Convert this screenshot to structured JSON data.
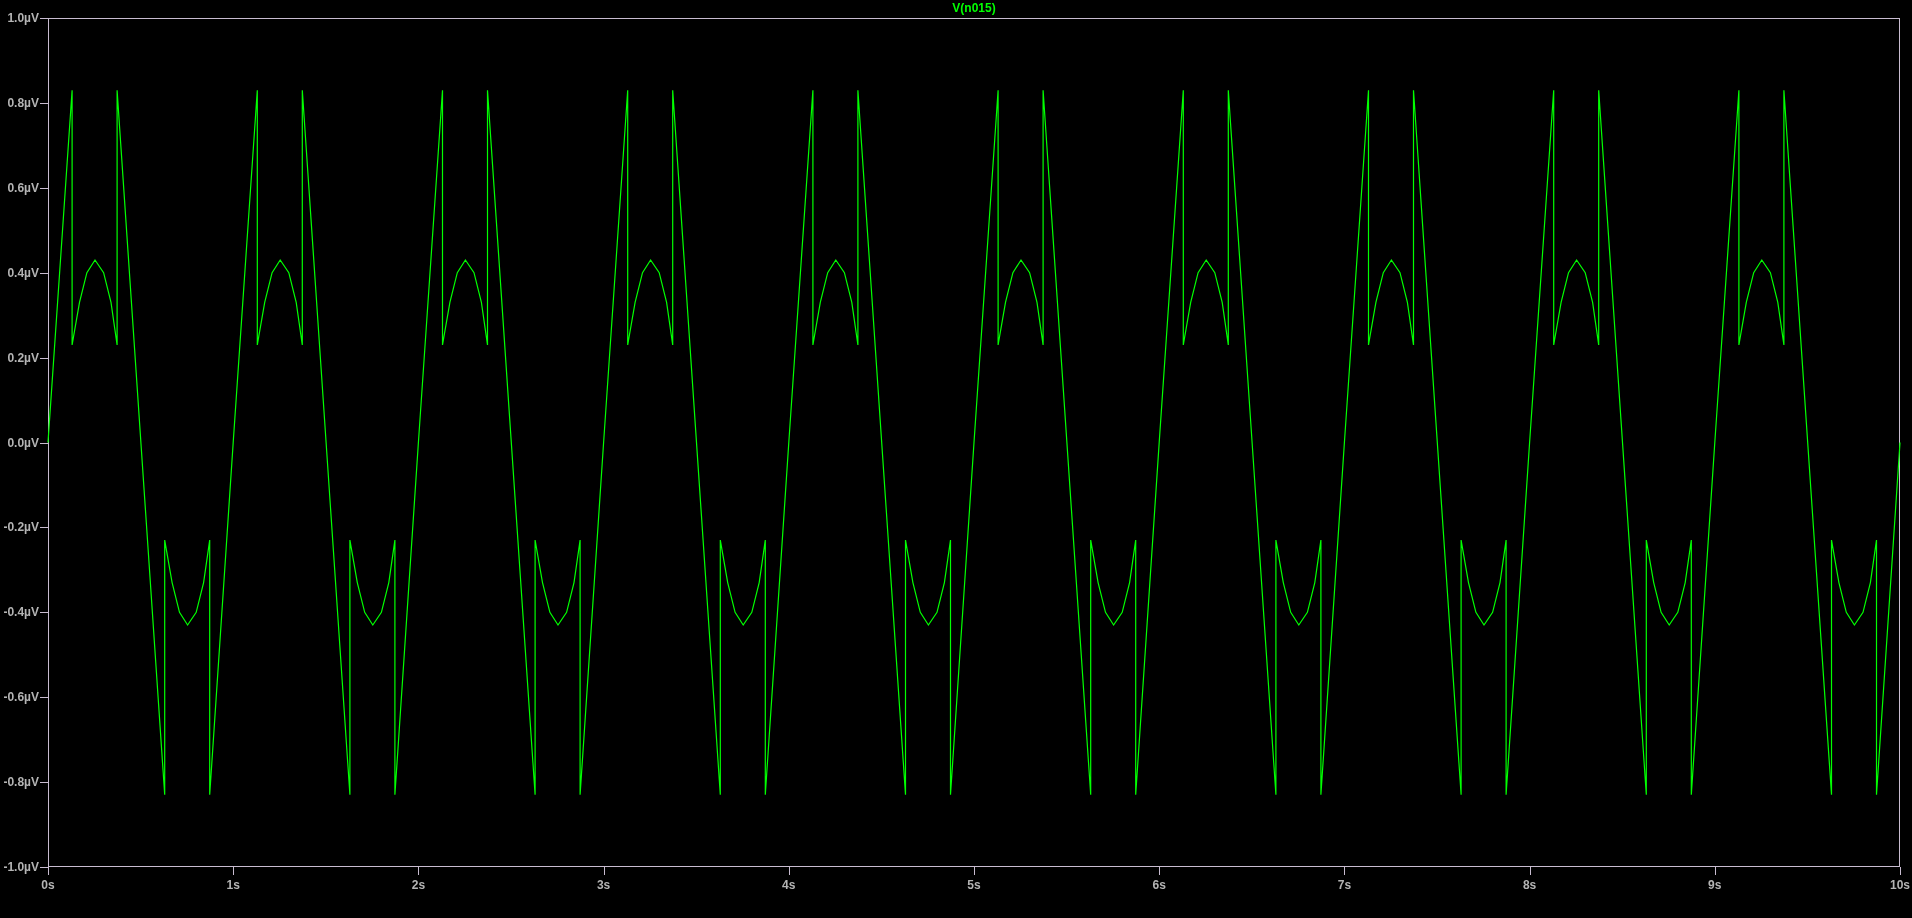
{
  "plot": {
    "chart_data": {
      "type": "line",
      "xlim": [
        0,
        10
      ],
      "ylim": [
        -1,
        1
      ],
      "xticks": [
        {
          "value": 0,
          "label": "0s"
        },
        {
          "value": 1,
          "label": "1s"
        },
        {
          "value": 2,
          "label": "2s"
        },
        {
          "value": 3,
          "label": "3s"
        },
        {
          "value": 4,
          "label": "4s"
        },
        {
          "value": 5,
          "label": "5s"
        },
        {
          "value": 6,
          "label": "6s"
        },
        {
          "value": 7,
          "label": "7s"
        },
        {
          "value": 8,
          "label": "8s"
        },
        {
          "value": 9,
          "label": "9s"
        },
        {
          "value": 10,
          "label": "10s"
        }
      ],
      "yticks": [
        {
          "value": 1,
          "label": "1.0µV"
        },
        {
          "value": 0.8,
          "label": "0.8µV"
        },
        {
          "value": 0.6,
          "label": "0.6µV"
        },
        {
          "value": 0.4,
          "label": "0.4µV"
        },
        {
          "value": 0.2,
          "label": "0.2µV"
        },
        {
          "value": 0,
          "label": "0.0µV"
        },
        {
          "value": -0.2,
          "label": "-0.2µV"
        },
        {
          "value": -0.4,
          "label": "-0.4µV"
        },
        {
          "value": -0.6,
          "label": "-0.6µV"
        },
        {
          "value": -0.8,
          "label": "-0.8µV"
        },
        {
          "value": -1,
          "label": "-1.0µV"
        }
      ],
      "x": [
        0,
        0.13,
        0.13,
        0.17,
        0.21,
        0.254,
        0.3,
        0.34,
        0.373,
        0.373,
        0.63,
        0.63,
        0.67,
        0.71,
        0.754,
        0.8,
        0.84,
        0.873,
        0.873,
        1,
        1.13,
        1.13,
        1.17,
        1.21,
        1.254,
        1.3,
        1.34,
        1.373,
        1.373,
        1.63,
        1.63,
        1.67,
        1.71,
        1.754,
        1.8,
        1.84,
        1.873,
        1.873,
        2,
        2.13,
        2.13,
        2.17,
        2.21,
        2.254,
        2.3,
        2.34,
        2.373,
        2.373,
        2.63,
        2.63,
        2.67,
        2.71,
        2.754,
        2.8,
        2.84,
        2.873,
        2.873,
        3,
        3.13,
        3.13,
        3.17,
        3.21,
        3.254,
        3.3,
        3.34,
        3.373,
        3.373,
        3.63,
        3.63,
        3.67,
        3.71,
        3.754,
        3.8,
        3.84,
        3.873,
        3.873,
        4,
        4.13,
        4.13,
        4.17,
        4.21,
        4.254,
        4.3,
        4.34,
        4.373,
        4.373,
        4.63,
        4.63,
        4.67,
        4.71,
        4.754,
        4.8,
        4.84,
        4.873,
        4.873,
        5,
        5.13,
        5.13,
        5.17,
        5.21,
        5.254,
        5.3,
        5.34,
        5.373,
        5.373,
        5.63,
        5.63,
        5.67,
        5.71,
        5.754,
        5.8,
        5.84,
        5.873,
        5.873,
        6,
        6.13,
        6.13,
        6.17,
        6.21,
        6.254,
        6.3,
        6.34,
        6.373,
        6.373,
        6.63,
        6.63,
        6.67,
        6.71,
        6.754,
        6.8,
        6.84,
        6.873,
        6.873,
        7,
        7.13,
        7.13,
        7.17,
        7.21,
        7.254,
        7.3,
        7.34,
        7.373,
        7.373,
        7.63,
        7.63,
        7.67,
        7.71,
        7.754,
        7.8,
        7.84,
        7.873,
        7.873,
        8,
        8.13,
        8.13,
        8.17,
        8.21,
        8.254,
        8.3,
        8.34,
        8.373,
        8.373,
        8.63,
        8.63,
        8.67,
        8.71,
        8.754,
        8.8,
        8.84,
        8.873,
        8.873,
        9,
        9.13,
        9.13,
        9.17,
        9.21,
        9.254,
        9.3,
        9.34,
        9.373,
        9.373,
        9.63,
        9.63,
        9.67,
        9.71,
        9.754,
        9.8,
        9.84,
        9.873,
        9.873,
        10
      ],
      "series": [
        {
          "name": "V(n015)",
          "color": "#00ff00",
          "values": [
            0,
            0.83,
            0.23,
            0.33,
            0.4,
            0.43,
            0.4,
            0.33,
            0.23,
            0.83,
            -0.83,
            -0.23,
            -0.33,
            -0.4,
            -0.43,
            -0.4,
            -0.33,
            -0.23,
            -0.83,
            0,
            0.83,
            0.23,
            0.33,
            0.4,
            0.43,
            0.4,
            0.33,
            0.23,
            0.83,
            -0.83,
            -0.23,
            -0.33,
            -0.4,
            -0.43,
            -0.4,
            -0.33,
            -0.23,
            -0.83,
            0,
            0.83,
            0.23,
            0.33,
            0.4,
            0.43,
            0.4,
            0.33,
            0.23,
            0.83,
            -0.83,
            -0.23,
            -0.33,
            -0.4,
            -0.43,
            -0.4,
            -0.33,
            -0.23,
            -0.83,
            0,
            0.83,
            0.23,
            0.33,
            0.4,
            0.43,
            0.4,
            0.33,
            0.23,
            0.83,
            -0.83,
            -0.23,
            -0.33,
            -0.4,
            -0.43,
            -0.4,
            -0.33,
            -0.23,
            -0.83,
            0,
            0.83,
            0.23,
            0.33,
            0.4,
            0.43,
            0.4,
            0.33,
            0.23,
            0.83,
            -0.83,
            -0.23,
            -0.33,
            -0.4,
            -0.43,
            -0.4,
            -0.33,
            -0.23,
            -0.83,
            0,
            0.83,
            0.23,
            0.33,
            0.4,
            0.43,
            0.4,
            0.33,
            0.23,
            0.83,
            -0.83,
            -0.23,
            -0.33,
            -0.4,
            -0.43,
            -0.4,
            -0.33,
            -0.23,
            -0.83,
            0,
            0.83,
            0.23,
            0.33,
            0.4,
            0.43,
            0.4,
            0.33,
            0.23,
            0.83,
            -0.83,
            -0.23,
            -0.33,
            -0.4,
            -0.43,
            -0.4,
            -0.33,
            -0.23,
            -0.83,
            0,
            0.83,
            0.23,
            0.33,
            0.4,
            0.43,
            0.4,
            0.33,
            0.23,
            0.83,
            -0.83,
            -0.23,
            -0.33,
            -0.4,
            -0.43,
            -0.4,
            -0.33,
            -0.23,
            -0.83,
            0,
            0.83,
            0.23,
            0.33,
            0.4,
            0.43,
            0.4,
            0.33,
            0.23,
            0.83,
            -0.83,
            -0.23,
            -0.33,
            -0.4,
            -0.43,
            -0.4,
            -0.33,
            -0.23,
            -0.83,
            0,
            0.83,
            0.23,
            0.33,
            0.4,
            0.43,
            0.4,
            0.33,
            0.23,
            0.83,
            -0.83,
            -0.23,
            -0.33,
            -0.4,
            -0.43,
            -0.4,
            -0.33,
            -0.23,
            -0.83,
            0
          ]
        }
      ]
    }
  }
}
